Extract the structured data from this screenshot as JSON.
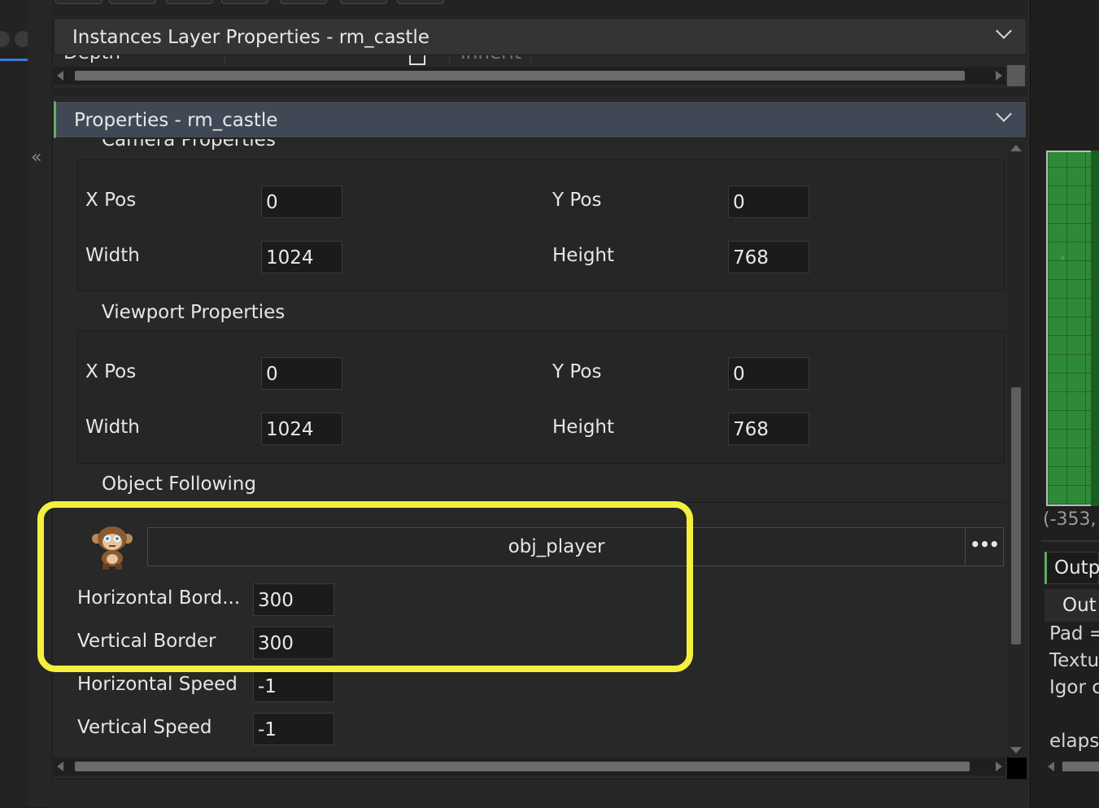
{
  "instances_panel": {
    "title": "Instances Layer Properties - rm_castle",
    "partial_label": "Depth",
    "partial_cell": "Inherit"
  },
  "properties_panel": {
    "title": "Properties - rm_castle"
  },
  "camera": {
    "title": "Camera Properties",
    "x_label": "X Pos",
    "x_value": "0",
    "y_label": "Y Pos",
    "y_value": "0",
    "w_label": "Width",
    "w_value": "1024",
    "h_label": "Height",
    "h_value": "768"
  },
  "viewport": {
    "title": "Viewport Properties",
    "x_label": "X Pos",
    "x_value": "0",
    "y_label": "Y Pos",
    "y_value": "0",
    "w_label": "Width",
    "w_value": "1024",
    "h_label": "Height",
    "h_value": "768"
  },
  "object_following": {
    "title": "Object Following",
    "object_name": "obj_player",
    "more_label": "•••",
    "hborder_label": "Horizontal Bord...",
    "hborder_value": "300",
    "vborder_label": "Vertical Border",
    "vborder_value": "300",
    "hspeed_label": "Horizontal Speed",
    "hspeed_value": "-1",
    "vspeed_label": "Vertical Speed",
    "vspeed_value": "-1"
  },
  "right_pane": {
    "coords": "(-353,",
    "output_tab": "Outp",
    "output_subtab": "Out",
    "lines": [
      "Pad =",
      "Textu",
      "Igor c",
      "elapse"
    ]
  },
  "colors": {
    "highlight": "#f5f040",
    "active_header": "#404856",
    "accent_green": "#5fae65"
  }
}
